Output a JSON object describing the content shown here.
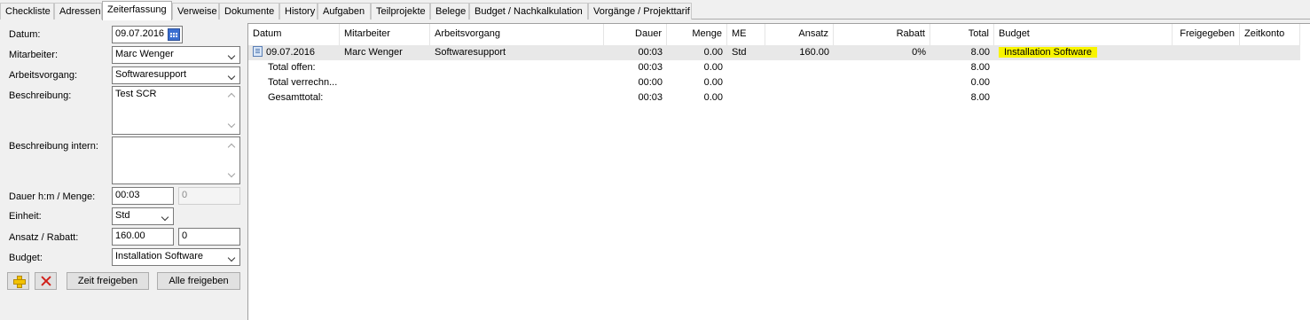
{
  "tabs": [
    {
      "label": "Checkliste",
      "active": false
    },
    {
      "label": "Adressen",
      "active": false
    },
    {
      "label": "Zeiterfassung",
      "active": true
    },
    {
      "label": "Verweise",
      "active": false
    },
    {
      "label": "Dokumente",
      "active": false
    },
    {
      "label": "History",
      "active": false
    },
    {
      "label": "Aufgaben",
      "active": false
    },
    {
      "label": "Teilprojekte",
      "active": false
    },
    {
      "label": "Belege",
      "active": false
    },
    {
      "label": "Budget / Nachkalkulation",
      "active": false
    },
    {
      "label": "Vorgänge / Projekttarif",
      "active": false
    }
  ],
  "form": {
    "datum_label": "Datum:",
    "datum_value": "09.07.2016",
    "mitarbeiter_label": "Mitarbeiter:",
    "mitarbeiter_value": "Marc Wenger",
    "arbeitsvorgang_label": "Arbeitsvorgang:",
    "arbeitsvorgang_value": "Softwaresupport",
    "beschreibung_label": "Beschreibung:",
    "beschreibung_value": "Test SCR",
    "beschreibung_intern_label": "Beschreibung intern:",
    "beschreibung_intern_value": "",
    "dauer_label": "Dauer h:m / Menge:",
    "dauer_value": "00:03",
    "menge_value": "0",
    "einheit_label": "Einheit:",
    "einheit_value": "Std",
    "ansatz_label": "Ansatz / Rabatt:",
    "ansatz_value": "160.00",
    "rabatt_value": "0",
    "budget_label": "Budget:",
    "budget_value": "Installation Software",
    "zeit_freigeben_label": "Zeit freigeben",
    "alle_freigeben_label": "Alle freigeben"
  },
  "grid": {
    "columns": [
      "Datum",
      "Mitarbeiter",
      "Arbeitsvorgang",
      "Dauer",
      "Menge",
      "ME",
      "Ansatz",
      "Rabatt",
      "Total",
      "Budget",
      "Freigegeben",
      "Zeitkonto"
    ],
    "entry": {
      "datum": "09.07.2016",
      "mitarbeiter": "Marc Wenger",
      "arbeitsvorgang": "Softwaresupport",
      "dauer": "00:03",
      "menge": "0.00",
      "me": "Std",
      "ansatz": "160.00",
      "rabatt": "0%",
      "total": "8.00",
      "budget": "Installation Software"
    },
    "totals": [
      {
        "label": "Total offen:",
        "dauer": "00:03",
        "menge": "0.00",
        "total": "8.00"
      },
      {
        "label": "Total verrechn...",
        "dauer": "00:00",
        "menge": "0.00",
        "total": "0.00"
      },
      {
        "label": "Gesamttotal:",
        "dauer": "00:03",
        "menge": "0.00",
        "total": "8.00"
      }
    ]
  },
  "colors": {
    "highlight": "#f8f400",
    "selected_row": "#e8e8e8"
  }
}
